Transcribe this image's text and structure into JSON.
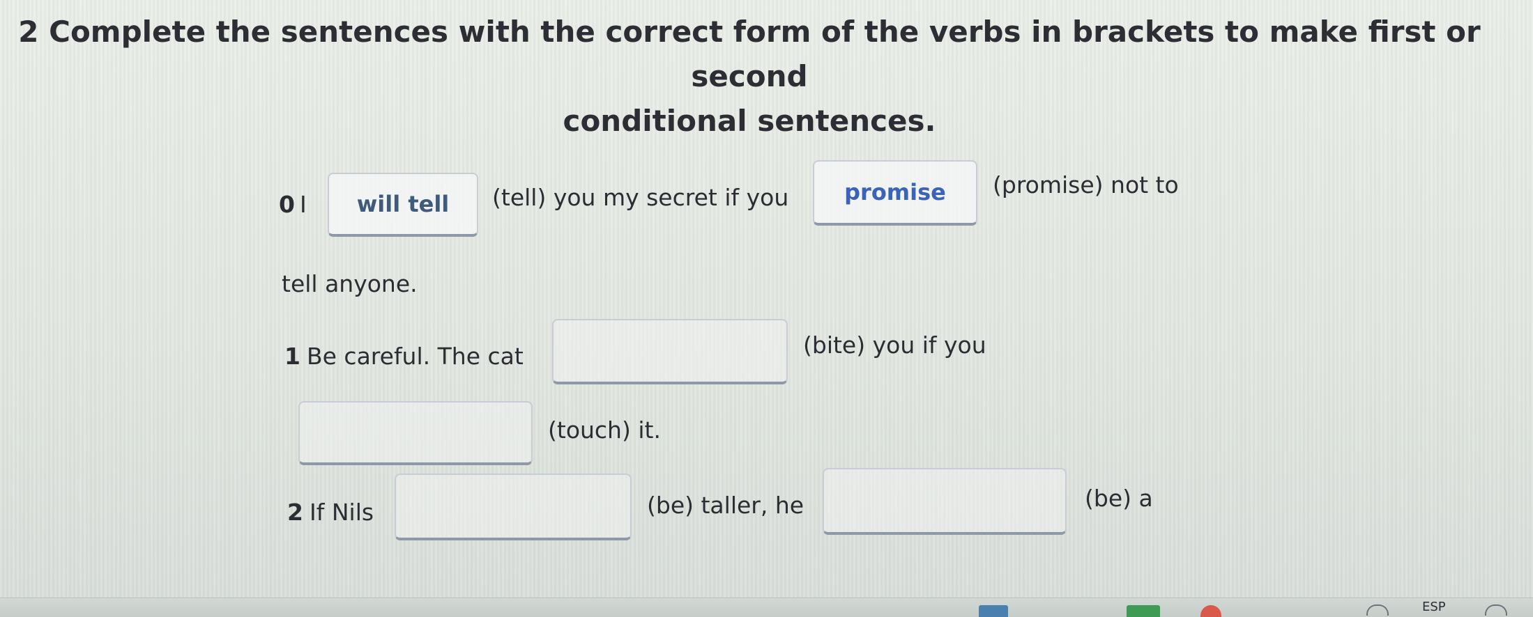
{
  "exercise": {
    "title_line1": "2 Complete the sentences with the correct form of the verbs in brackets to make first or second",
    "title_line2": "conditional sentences."
  },
  "sentences": [
    {
      "number": "0",
      "start": "I",
      "answer1": "will tell",
      "text1": "(tell) you my secret if you",
      "answer2": "promise",
      "text2": "(promise) not to",
      "text3": "tell anyone."
    },
    {
      "number": "1",
      "start": "Be careful. The cat",
      "text1": "(bite) you if you",
      "text2": "(touch) it."
    },
    {
      "number": "2",
      "start": "If Nils",
      "text1": "(be) taller, he",
      "text2": "(be) a"
    }
  ],
  "taskbar": {
    "language": "ESP"
  },
  "colors": {
    "background": "#e4e9e3",
    "answer_text": "#3f5a7a",
    "answer_text_highlight": "#3b63b8",
    "box_border": "#c9ccd2",
    "box_underline": "#8d98a8"
  }
}
